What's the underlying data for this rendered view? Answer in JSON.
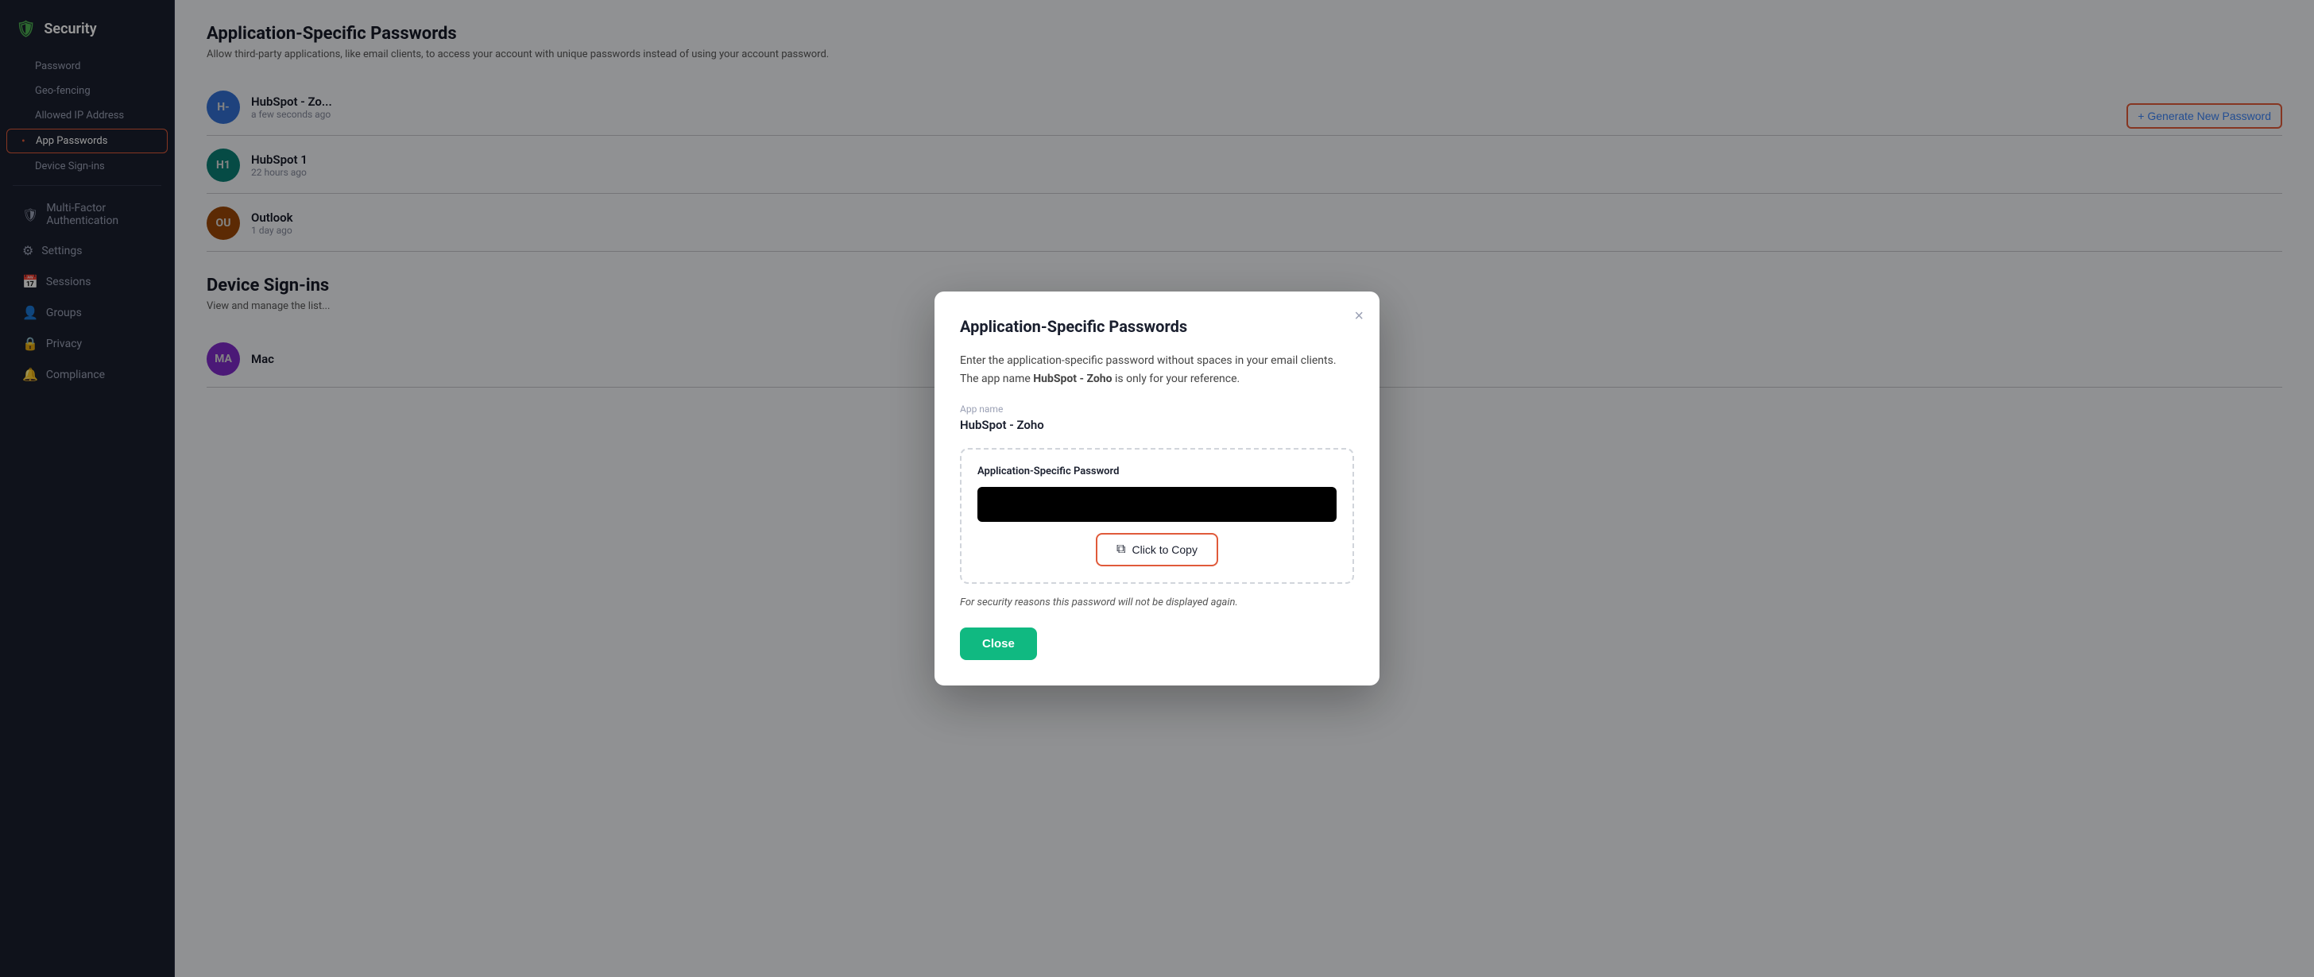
{
  "sidebar": {
    "title": "Security",
    "title_icon": "🛡",
    "items": [
      {
        "label": "Password",
        "active": false,
        "sub": true
      },
      {
        "label": "Geo-fencing",
        "active": false,
        "sub": true
      },
      {
        "label": "Allowed IP Address",
        "active": false,
        "sub": true
      },
      {
        "label": "App Passwords",
        "active": true,
        "sub": true
      },
      {
        "label": "Device Sign-ins",
        "active": false,
        "sub": true
      }
    ],
    "sections": [
      {
        "label": "Multi-Factor Authentication",
        "icon": "🛡"
      },
      {
        "label": "Settings",
        "icon": "⚙"
      },
      {
        "label": "Sessions",
        "icon": "📅"
      },
      {
        "label": "Groups",
        "icon": "👤"
      },
      {
        "label": "Privacy",
        "icon": "🔒"
      },
      {
        "label": "Compliance",
        "icon": "🔔"
      }
    ]
  },
  "main": {
    "app_passwords": {
      "title": "Application-Specific Passwords",
      "description": "Allow third-party applications, like email clients, to access your account with unique passwords instead of using your account password.",
      "generate_label": "+ Generate New Password",
      "items": [
        {
          "initials": "H-",
          "name": "HubSpot - Zo...",
          "time": "a few seconds ago",
          "color": "avatar-blue"
        },
        {
          "initials": "H1",
          "name": "HubSpot 1",
          "time": "22 hours ago",
          "color": "avatar-teal"
        },
        {
          "initials": "OU",
          "name": "Outlook",
          "time": "1 day ago",
          "color": "avatar-gold"
        }
      ]
    },
    "device_signins": {
      "title": "Device Sign-ins",
      "description": "View and manage the list...",
      "items": [
        {
          "initials": "MA",
          "name": "Mac",
          "color": "avatar-purple"
        }
      ]
    }
  },
  "modal": {
    "title": "Application-Specific Passwords",
    "close_label": "×",
    "description_part1": "Enter the application-specific password without spaces in your email clients. The app name ",
    "app_name_bold": "HubSpot - Zoho",
    "description_part2": " is only for your reference.",
    "app_name_label": "App name",
    "app_name_value": "HubSpot - Zoho",
    "password_section_label": "Application-Specific Password",
    "copy_button_label": "Click to Copy",
    "security_note": "For security reasons this password will not be displayed again.",
    "close_button_label": "Close"
  }
}
